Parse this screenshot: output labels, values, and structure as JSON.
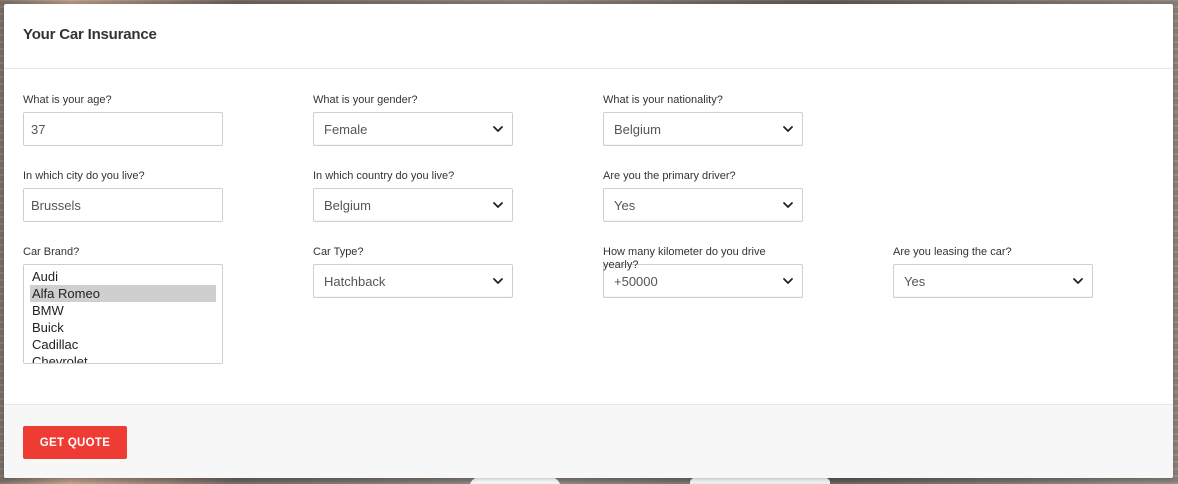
{
  "form": {
    "title": "Your Car Insurance",
    "age": {
      "label": "What is your age?",
      "value": "37"
    },
    "gender": {
      "label": "What is your gender?",
      "value": "Female"
    },
    "nationality": {
      "label": "What is your nationality?",
      "value": "Belgium"
    },
    "city": {
      "label": "In which city do you live?",
      "value": "Brussels"
    },
    "country": {
      "label": "In which country do you live?",
      "value": "Belgium"
    },
    "primary_driver": {
      "label": "Are you the primary driver?",
      "value": "Yes"
    },
    "car_brand": {
      "label": "Car Brand?",
      "options": [
        "Audi",
        "Alfa Romeo",
        "BMW",
        "Buick",
        "Cadillac",
        "Chevrolet"
      ],
      "selected": "Alfa Romeo"
    },
    "car_type": {
      "label": "Car Type?",
      "value": "Hatchback"
    },
    "km_yearly": {
      "label": "How many kilometer do you drive yearly?",
      "value": "+50000"
    },
    "leasing": {
      "label": "Are you leasing the car?",
      "value": "Yes"
    },
    "submit_label": "GET QUOTE"
  },
  "colors": {
    "accent": "#ee3c35",
    "selected_option_bg": "#cfcfcf",
    "footer_bg": "#f7f7f7"
  },
  "icons": {
    "select_arrow": "chevron-down-icon"
  }
}
